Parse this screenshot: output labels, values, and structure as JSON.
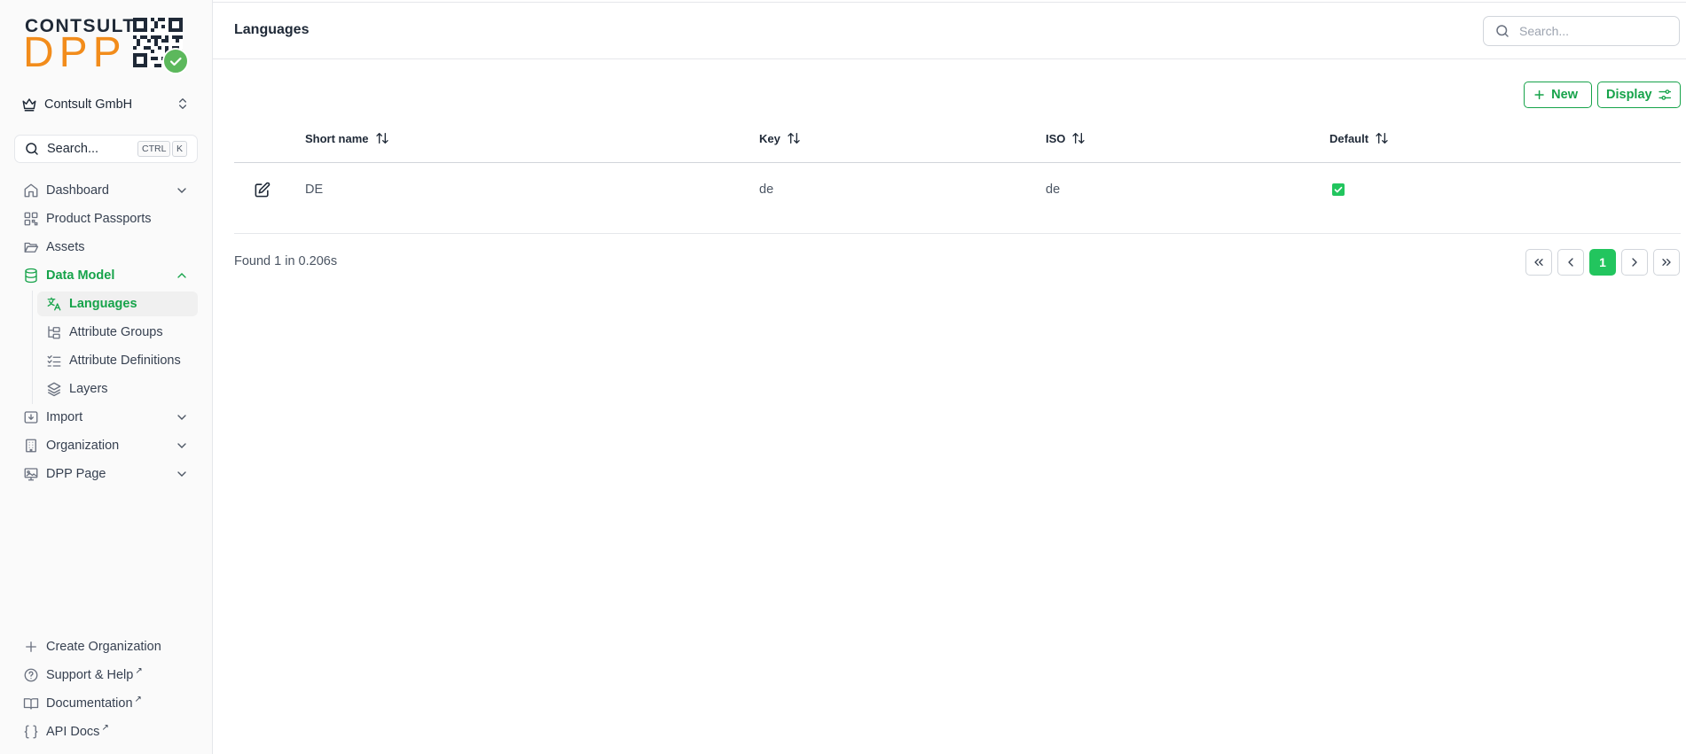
{
  "logo": {
    "line1": "CONTSULT",
    "line2": "DPP"
  },
  "org": {
    "name": "Contsult GmbH"
  },
  "sidebar_search": {
    "label": "Search...",
    "kbd": [
      "CTRL",
      "K"
    ]
  },
  "nav": {
    "dashboard": "Dashboard",
    "product_passports": "Product Passports",
    "assets": "Assets",
    "data_model": "Data Model",
    "sub": {
      "languages": "Languages",
      "attribute_groups": "Attribute Groups",
      "attribute_definitions": "Attribute Definitions",
      "layers": "Layers"
    },
    "import": "Import",
    "organization": "Organization",
    "dpp_page": "DPP Page"
  },
  "footer": {
    "create_org": "Create Organization",
    "support": "Support & Help",
    "docs": "Documentation",
    "api": "API Docs"
  },
  "header": {
    "title": "Languages",
    "search_placeholder": "Search..."
  },
  "toolbar": {
    "new_label": "New",
    "display_label": "Display"
  },
  "table": {
    "columns": [
      "Short name",
      "Key",
      "ISO",
      "Default"
    ],
    "rows": [
      {
        "short_name": "DE",
        "key": "de",
        "iso": "de",
        "default": true
      }
    ]
  },
  "footer_status": "Found 1 in 0.206s",
  "pagination": {
    "current": "1"
  },
  "colors": {
    "accent": "#16a34a",
    "brand_orange": "#f28c1b",
    "check": "#22c55e"
  }
}
